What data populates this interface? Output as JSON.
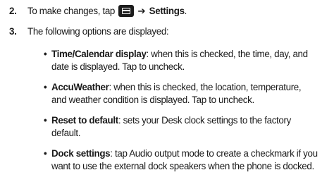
{
  "steps": [
    {
      "number": "2.",
      "text_before_icon": "To make changes, tap ",
      "icon": "menu-icon",
      "arrow": "➔",
      "text_bold_after": "Settings",
      "text_end": "."
    },
    {
      "number": "3.",
      "text": "The following options are displayed:"
    }
  ],
  "options": [
    {
      "term": "Time/Calendar display",
      "line1_rest": ": when this is checked, the time, day, and",
      "line2": "date is displayed. Tap to uncheck."
    },
    {
      "term": "AccuWeather",
      "line1_rest": ": when this is checked, the location, temperature,",
      "line2": "and weather condition is displayed. Tap to uncheck."
    },
    {
      "term": "Reset to default",
      "line1_rest": ": sets your Desk clock settings to the factory",
      "line2": "default."
    },
    {
      "term": "Dock settings",
      "line1_rest": ": tap Audio output mode to create a checkmark if you",
      "line2": "want to use the external dock speakers when the phone is docked."
    }
  ],
  "bullet_glyph": "•"
}
